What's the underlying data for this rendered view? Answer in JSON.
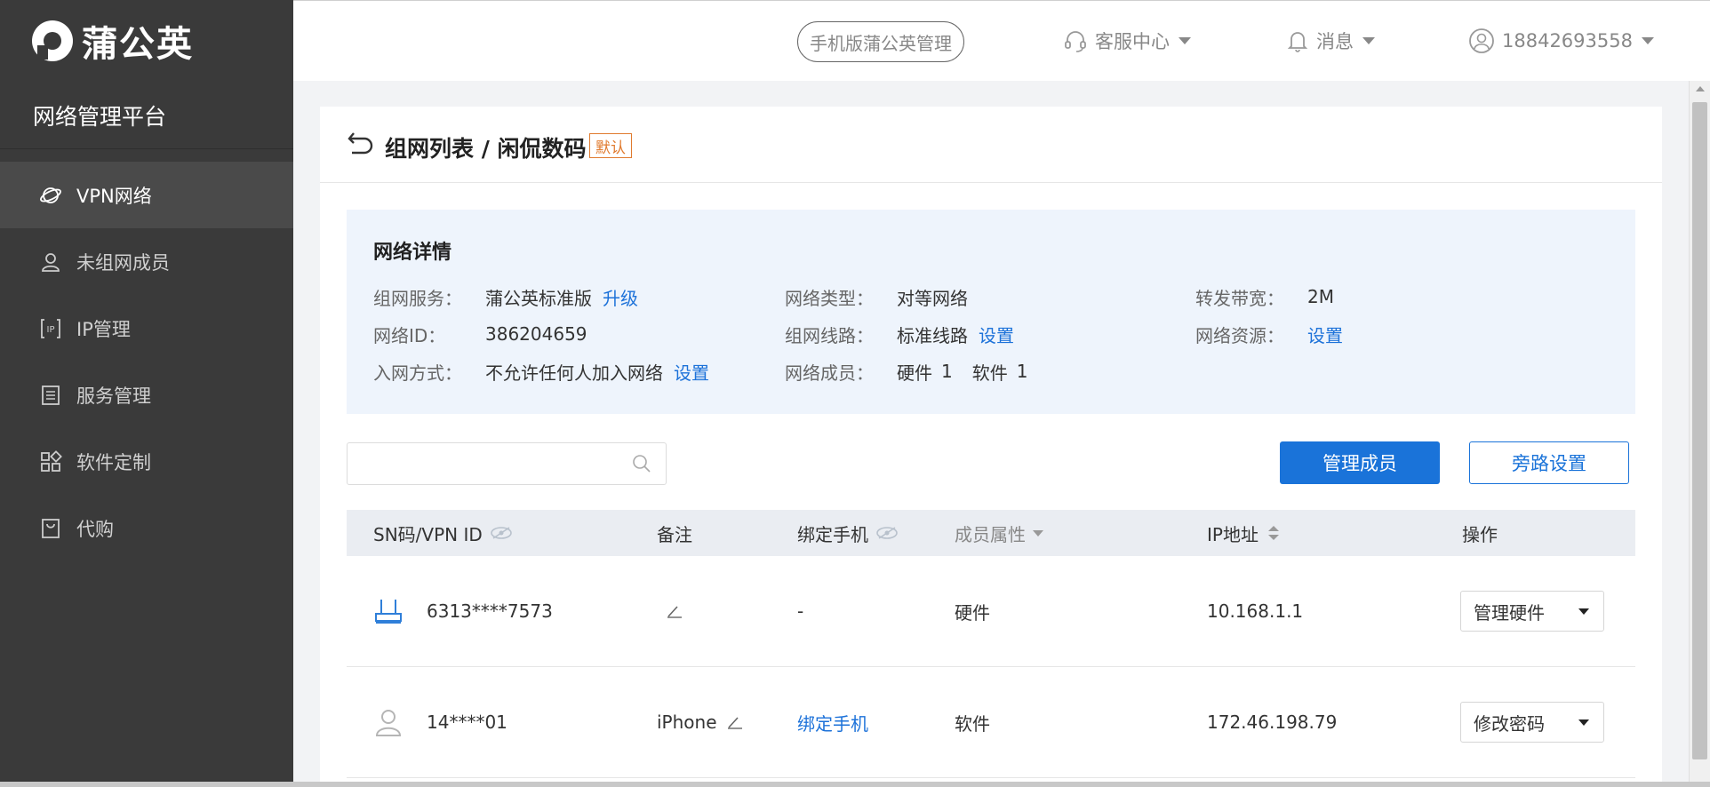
{
  "app": {
    "logo_text": "蒲公英",
    "platform_title": "网络管理平台"
  },
  "sidebar": {
    "items": [
      {
        "label": "VPN网络",
        "icon": "planet-icon",
        "active": true
      },
      {
        "label": "未组网成员",
        "icon": "user-icon",
        "active": false
      },
      {
        "label": "IP管理",
        "icon": "ip-icon",
        "active": false
      },
      {
        "label": "服务管理",
        "icon": "list-doc-icon",
        "active": false
      },
      {
        "label": "软件定制",
        "icon": "grid-apps-icon",
        "active": false
      },
      {
        "label": "代购",
        "icon": "shopping-bag-icon",
        "active": false
      }
    ]
  },
  "header": {
    "mobile_button": "手机版蒲公英管理",
    "service_center": "客服中心",
    "messages": "消息",
    "account": "18842693558"
  },
  "page": {
    "title": "组网列表 / 闲侃数码",
    "badge": "默认"
  },
  "network_detail": {
    "title": "网络详情",
    "service_label": "组网服务：",
    "service_value": "蒲公英标准版",
    "service_link": "升级",
    "type_label": "网络类型：",
    "type_value": "对等网络",
    "bandwidth_label": "转发带宽：",
    "bandwidth_value": "2M",
    "id_label": "网络ID：",
    "id_value": "386204659",
    "line_label": "组网线路：",
    "line_value": "标准线路",
    "line_link": "设置",
    "resource_label": "网络资源：",
    "resource_link": "设置",
    "join_label": "入网方式：",
    "join_value": "不允许任何人加入网络",
    "join_link": "设置",
    "members_label": "网络成员：",
    "members_hw_label": "硬件",
    "members_hw_count": "1",
    "members_sw_label": "软件",
    "members_sw_count": "1"
  },
  "toolbar": {
    "search_placeholder": "",
    "manage_members": "管理成员",
    "bypass_settings": "旁路设置"
  },
  "table": {
    "columns": {
      "sn": "SN码/VPN ID",
      "note": "备注",
      "phone": "绑定手机",
      "attr": "成员属性",
      "ip": "IP地址",
      "op": "操作"
    },
    "rows": [
      {
        "icon": "router-icon",
        "sn": "6313****7573",
        "note": "",
        "phone": "-",
        "phone_is_link": false,
        "attr": "硬件",
        "ip": "10.168.1.1",
        "op": "管理硬件"
      },
      {
        "icon": "person-icon",
        "sn": "14****01",
        "note": "iPhone",
        "phone": "绑定手机",
        "phone_is_link": true,
        "attr": "软件",
        "ip": "172.46.198.79",
        "op": "修改密码"
      }
    ]
  },
  "colors": {
    "sidebar_bg": "#3a3a3a",
    "primary": "#1a73d9",
    "badge": "#e07b2f",
    "detail_bg": "#eef4fc"
  }
}
